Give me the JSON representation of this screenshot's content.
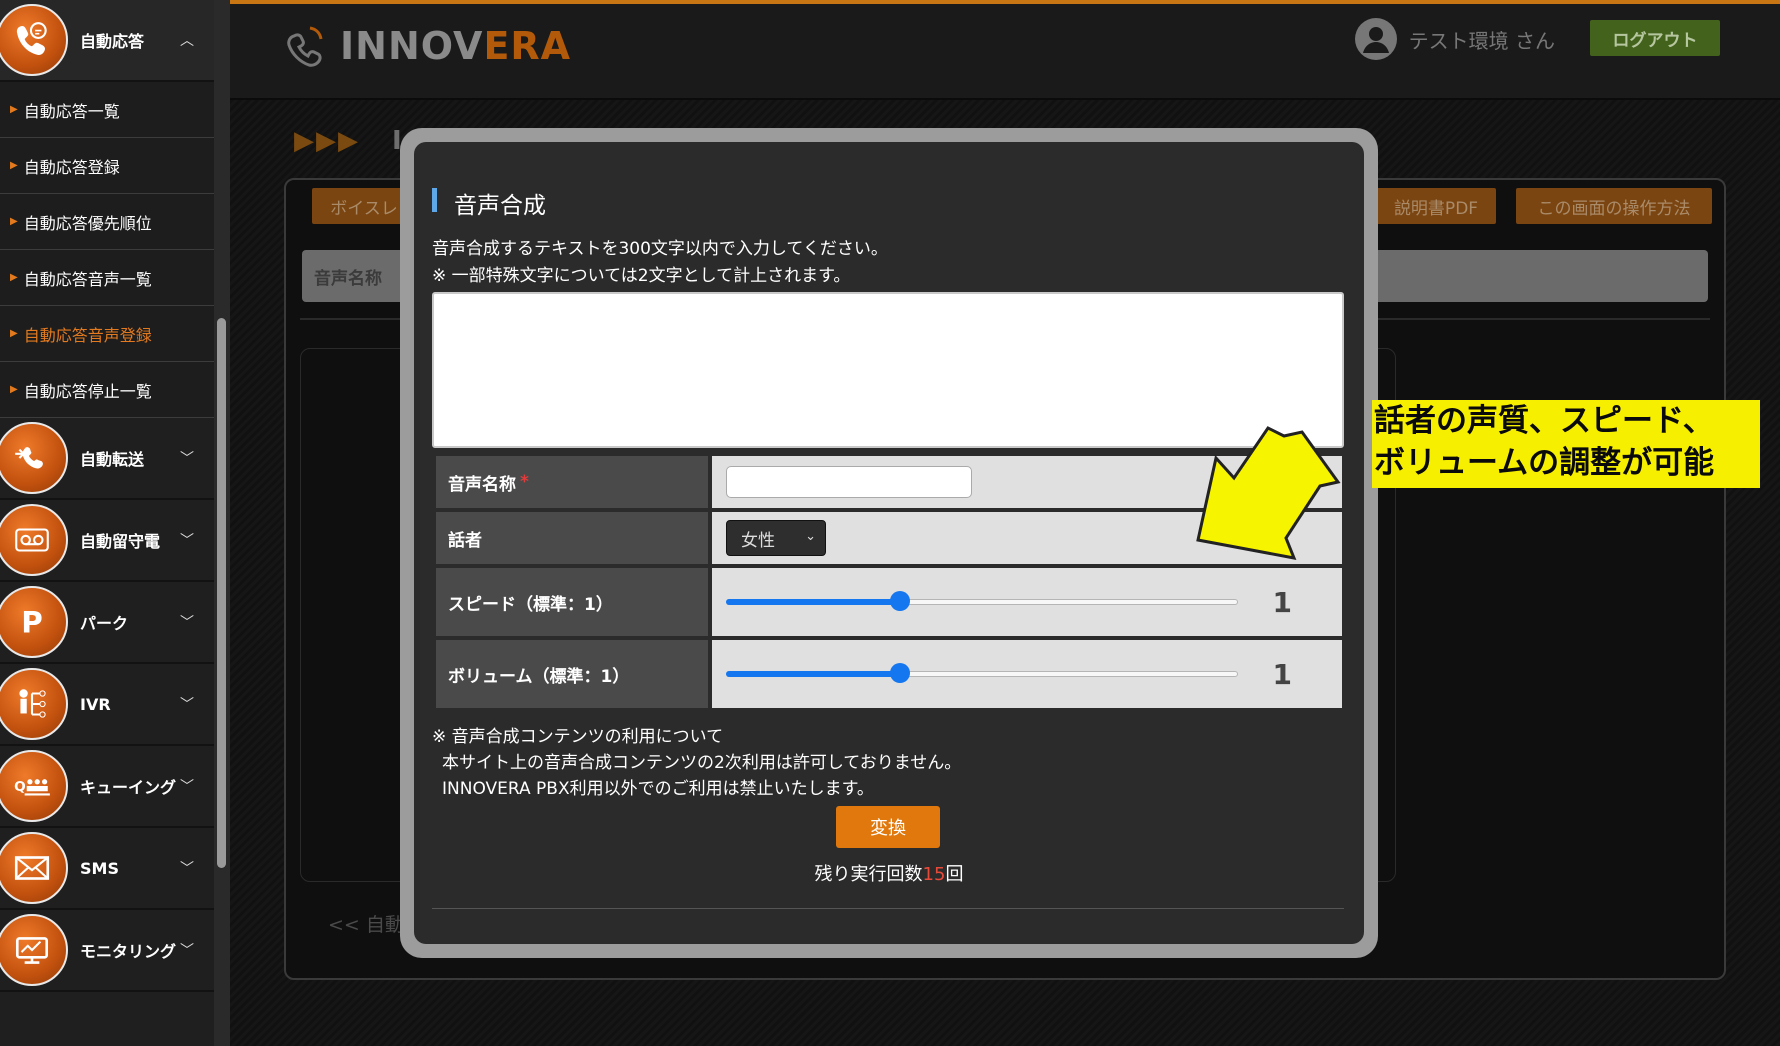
{
  "sidebar": {
    "auto_answer": {
      "label": "自動応答",
      "chevron": "︿",
      "items": [
        {
          "label": "自動応答一覧"
        },
        {
          "label": "自動応答登録"
        },
        {
          "label": "自動応答優先順位"
        },
        {
          "label": "自動応答音声一覧"
        },
        {
          "label": "自動応答音声登録",
          "current": true
        },
        {
          "label": "自動応答停止一覧"
        }
      ]
    },
    "menus": [
      {
        "label": "自動転送",
        "icon": "transfer-phone-icon"
      },
      {
        "label": "自動留守電",
        "icon": "voicemail-icon"
      },
      {
        "label": "パーク",
        "icon": "park-p-icon"
      },
      {
        "label": "IVR",
        "icon": "ivr-tree-icon"
      },
      {
        "label": "キューイング",
        "icon": "queue-icon"
      },
      {
        "label": "SMS",
        "icon": "envelope-icon"
      },
      {
        "label": "モニタリング",
        "icon": "monitor-icon"
      }
    ],
    "chevron_down": "﹀"
  },
  "header": {
    "logo_part1": "INNOV",
    "logo_part2": "ERA",
    "user_name": "テスト環境 さん",
    "logout_label": "ログアウト"
  },
  "background_page": {
    "crumb_arrows": "▶▶▶",
    "crumb_title": "I",
    "button_voice_list": "ボイスレ",
    "button_manual_pdf": "説明書PDF",
    "button_howto": "この画面の操作方法",
    "row_label": "音声名称",
    "back_link": "<<   自動"
  },
  "modal": {
    "title": "音声合成",
    "desc_line1": "音声合成するテキストを300文字以内で入力してください。",
    "desc_line2": "※ 一部特殊文字については2文字として計上されます。",
    "text_value": "",
    "fields": {
      "name_label": "音声名称",
      "required_mark": "*",
      "name_value": "",
      "speaker_label": "話者",
      "speaker_value": "女性",
      "speed_label": "スピード（標準：1）",
      "speed_value": "1",
      "speed_level": 0.34,
      "volume_label": "ボリューム（標準：1）",
      "volume_value": "1",
      "volume_level": 0.34
    },
    "note_line1": "※ 音声合成コンテンツの利用について",
    "note_line2": "本サイト上の音声合成コンテンツの2次利用は許可しておりません。",
    "note_line3": "INNOVERA  PBX利用以外でのご利用は禁止いたします。",
    "convert_label": "変換",
    "remain_prefix": "残り実行回数",
    "remain_count": "15",
    "remain_suffix": "回"
  },
  "annotation": {
    "line1": "話者の声質、スピード、",
    "line2": "ボリュームの調整が可能",
    "bg_color": "#f7ef00"
  },
  "colors": {
    "accent": "#e0780e",
    "slider": "#1477f0"
  }
}
